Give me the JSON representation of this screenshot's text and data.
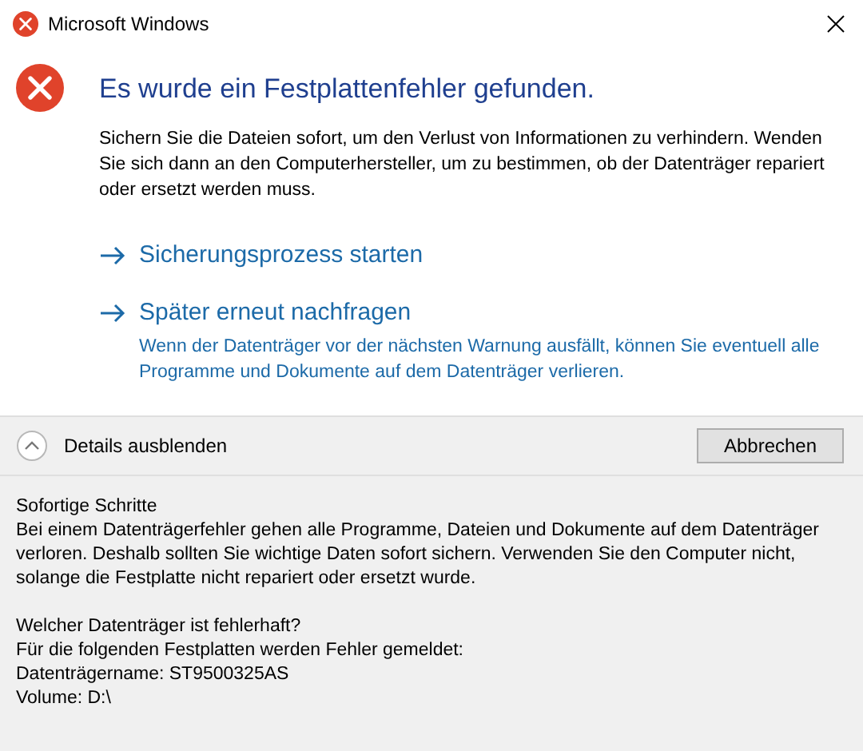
{
  "window": {
    "title": "Microsoft Windows"
  },
  "heading": "Es wurde ein Festplattenfehler gefunden.",
  "message": "Sichern Sie die Dateien sofort, um den Verlust von Informationen zu verhindern. Wenden Sie sich dann an den Computerhersteller, um zu bestimmen, ob der Datenträger repariert oder ersetzt werden muss.",
  "actions": [
    {
      "label": "Sicherungsprozess starten"
    },
    {
      "label": "Später erneut nachfragen",
      "description": "Wenn der Datenträger vor der nächsten Warnung ausfällt, können Sie eventuell alle Programme und Dokumente auf dem Datenträger verlieren."
    }
  ],
  "details_toggle": {
    "label": "Details ausblenden",
    "expanded": true
  },
  "buttons": [
    "Abbrechen"
  ],
  "details": [
    {
      "title": "Sofortige Schritte",
      "lines": [
        "Bei einem Datenträgerfehler gehen alle Programme, Dateien und Dokumente auf dem Datenträger verloren. Deshalb sollten Sie wichtige Daten sofort sichern. Verwenden Sie den Computer nicht, solange die Festplatte nicht repariert oder ersetzt wurde."
      ]
    },
    {
      "title": "Welcher Datenträger ist fehlerhaft?",
      "lines": [
        "Für die folgenden Festplatten werden Fehler gemeldet:",
        "Datenträgername: ST9500325AS",
        "Volume: D:\\"
      ]
    }
  ]
}
